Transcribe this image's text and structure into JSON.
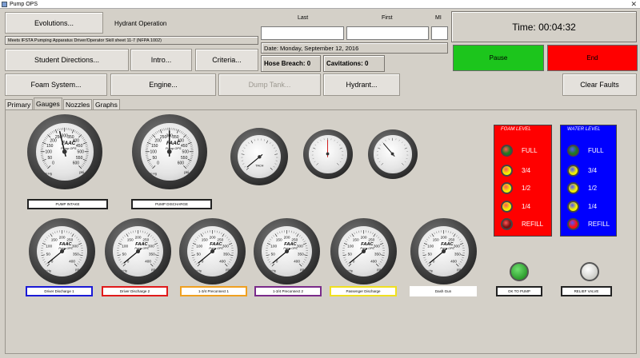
{
  "window": {
    "title": "Pump OPS"
  },
  "header": {
    "evolutions_label": "Evolutions...",
    "operation": "Hydrant Operation",
    "standard": "Meets IFSTA Pumping Apparatus Driver/Operator Skill sheet 11-7 (NFPA 1002)",
    "last_label": "Last",
    "first_label": "First",
    "mi_label": "MI",
    "last_value": "",
    "first_value": "",
    "mi_value": "",
    "date": "Date: Monday, September 12, 2016",
    "hose_breach": "Hose Breach: 0",
    "cavitations": "Cavitations: 0",
    "time": "Time: 00:04:32"
  },
  "buttons": {
    "student_directions": "Student Directions...",
    "intro": "Intro...",
    "criteria": "Criteria...",
    "foam_system": "Foam System...",
    "engine": "Engine...",
    "dump_tank": "Dump Tank...",
    "hydrant": "Hydrant...",
    "clear_faults": "Clear Faults",
    "pause": "Pause",
    "end": "End"
  },
  "tabs": [
    "Primary",
    "Gauges",
    "Nozzles",
    "Graphs"
  ],
  "gauges": {
    "brand": "FAAC",
    "model": "Pump OPS",
    "unit": "psi",
    "hg": "in Hg",
    "large_ticks": [
      "0",
      "50",
      "100",
      "150",
      "200",
      "250",
      "300",
      "350",
      "400",
      "450",
      "500",
      "550",
      "600"
    ],
    "small_ticks": [
      "0",
      "50",
      "100",
      "150",
      "200",
      "250",
      "300",
      "350",
      "400"
    ],
    "tach_label": "TACH",
    "pump_intake": "PUMP INTAKE",
    "pump_discharge": "PUMP DISCHARGE",
    "discharges": [
      "Driver Discharge 1",
      "Driver Discharge 2",
      "1-3/4 Preconnect 1",
      "1-3/4 Preconnect 2",
      "Passenger Discharge",
      "Dash Gun"
    ],
    "discharge_colors": [
      "#1a1ad6",
      "#e01a1a",
      "#f0a020",
      "#7a2a8a",
      "#f0e020",
      "#ffffff"
    ]
  },
  "foam_level": {
    "title": "FOAM LEVEL",
    "bg": "#ff0000",
    "levels": [
      "FULL",
      "3/4",
      "1/2",
      "1/4",
      "REFILL"
    ],
    "led_colors": [
      "#1f7a1f",
      "#f2f200",
      "#f2f200",
      "#f2f200",
      "#7a1010"
    ]
  },
  "water_level": {
    "title": "WATER LEVEL",
    "bg": "#0000ff",
    "levels": [
      "FULL",
      "3/4",
      "1/2",
      "1/4",
      "REFILL"
    ],
    "led_colors": [
      "#1f7a1f",
      "#f2f200",
      "#f2f200",
      "#f2f200",
      "#ff1010"
    ]
  },
  "indicators": {
    "ok_to_pump": "OK TO PUMP",
    "relief_valve": "RELIEF VALVE"
  },
  "colors": {
    "pause": "#1cc51c",
    "end": "#ff0000"
  }
}
